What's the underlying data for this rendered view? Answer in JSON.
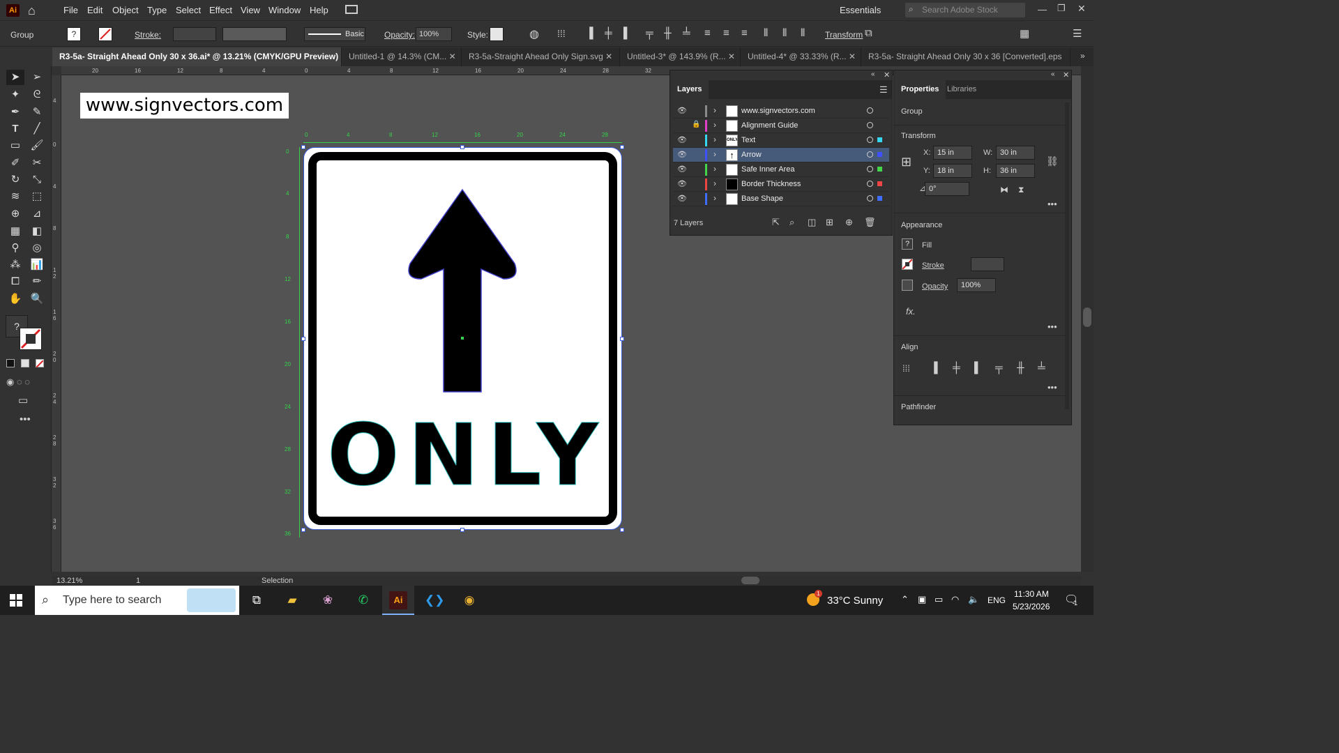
{
  "app": {
    "logo": "Ai",
    "menu": [
      "File",
      "Edit",
      "Object",
      "Type",
      "Select",
      "Effect",
      "View",
      "Window",
      "Help"
    ],
    "workspace": "Essentials",
    "stock_search_placeholder": "Search Adobe Stock"
  },
  "control_bar": {
    "selection_type": "Group",
    "stroke_label": "Stroke:",
    "brush_label": "Basic",
    "opacity_label": "Opacity:",
    "opacity_value": "100%",
    "style_label": "Style:",
    "transform_label": "Transform"
  },
  "tabs": [
    {
      "label": "R3-5a- Straight Ahead Only 30 x 36.ai* @ 13.21% (CMYK/GPU Preview)",
      "active": true
    },
    {
      "label": "Untitled-1 @ 14.3% (CM...",
      "active": false
    },
    {
      "label": "R3-5a-Straight Ahead Only Sign.svg",
      "active": false
    },
    {
      "label": "Untitled-3* @ 143.9% (R...",
      "active": false
    },
    {
      "label": "Untitled-4* @ 33.33% (R...",
      "active": false
    },
    {
      "label": "R3-5a- Straight Ahead Only 30 x 36 [Converted].eps",
      "active": false
    }
  ],
  "rulers": {
    "top": [
      "20",
      "16",
      "12",
      "8",
      "4",
      "0",
      "4",
      "8",
      "12",
      "16",
      "20",
      "24",
      "28",
      "32"
    ],
    "left": [
      "4",
      "0",
      "4",
      "8",
      "1 2",
      "1 6",
      "2 0",
      "2 4",
      "2 8",
      "3 2",
      "3 6"
    ],
    "artboard_top": [
      "0",
      "4",
      "8",
      "12",
      "16",
      "20",
      "24",
      "28"
    ],
    "artboard_left": [
      "0",
      "4",
      "8",
      "12",
      "16",
      "20",
      "24",
      "28",
      "32",
      "36"
    ]
  },
  "canvas": {
    "watermark": "www.signvectors.com",
    "sign_text": "ONLY"
  },
  "layers_panel": {
    "title": "Layers",
    "layers": [
      {
        "name": "www.signvectors.com",
        "visible": true,
        "locked": false,
        "color": "#8a8a8a",
        "thumb": "",
        "selected": false
      },
      {
        "name": "Alignment Guide",
        "visible": false,
        "locked": true,
        "color": "#e040c8",
        "thumb": "",
        "selected": false
      },
      {
        "name": "Text",
        "visible": true,
        "locked": false,
        "color": "#35d8f0",
        "thumb": "ONLY",
        "selected": false
      },
      {
        "name": "Arrow",
        "visible": true,
        "locked": false,
        "color": "#3f51ff",
        "thumb": "↑",
        "selected": true
      },
      {
        "name": "Safe Inner Area",
        "visible": true,
        "locked": false,
        "color": "#43d64a",
        "thumb": "",
        "selected": false
      },
      {
        "name": "Border Thickness",
        "visible": true,
        "locked": false,
        "color": "#ef4545",
        "thumb": "",
        "selected": false
      },
      {
        "name": "Base Shape",
        "visible": true,
        "locked": false,
        "color": "#3f6dff",
        "thumb": "",
        "selected": false
      }
    ],
    "count_label": "7 Layers"
  },
  "properties_panel": {
    "tabs": [
      "Properties",
      "Libraries"
    ],
    "selection": "Group",
    "transform_title": "Transform",
    "x_label": "X:",
    "x_value": "15 in",
    "y_label": "Y:",
    "y_value": "18 in",
    "w_label": "W:",
    "w_value": "30 in",
    "h_label": "H:",
    "h_value": "36 in",
    "angle_value": "0°",
    "appearance_title": "Appearance",
    "fill_label": "Fill",
    "stroke_label": "Stroke",
    "opacity_label": "Opacity",
    "opacity_value": "100%",
    "fx_label": "fx.",
    "align_title": "Align",
    "pathfinder_title": "Pathfinder"
  },
  "status_bar": {
    "zoom": "13.21%",
    "artboard_num": "1",
    "tool": "Selection"
  },
  "taskbar": {
    "search_placeholder": "Type here to search",
    "weather": "33°C  Sunny",
    "weather_badge": "1",
    "language": "ENG",
    "time": "11:30 AM",
    "date": "5/23/2026",
    "notification_count": "1"
  }
}
